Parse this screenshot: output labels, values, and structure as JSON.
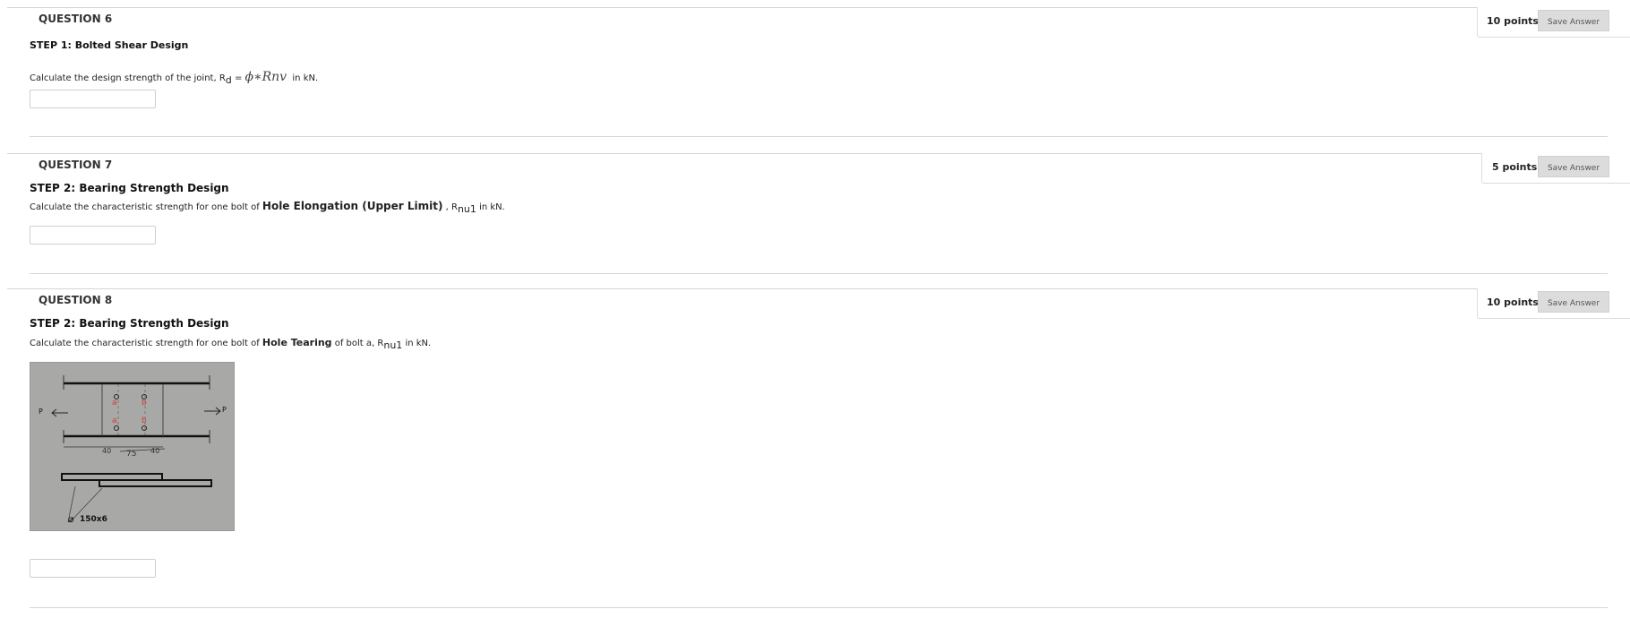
{
  "q6": {
    "title": "QUESTION 6",
    "points": "10 points",
    "save": "Save Answer",
    "step": "STEP 1: Bolted Shear Design",
    "prompt_pre": "Calculate the design strength of the joint, R",
    "prompt_sub": "d",
    "prompt_eq": " = ",
    "formula": "ϕ∗Rnv",
    "prompt_post": "  in kN.",
    "answer": ""
  },
  "q7": {
    "title": "QUESTION 7",
    "points": "5 points",
    "save": "Save Answer",
    "step": "STEP 2: Bearing Strength Design",
    "prompt_pre": "Calculate the characteristic strength for one bolt of ",
    "prompt_bold": "Hole Elongation (Upper Limit)",
    "prompt_mid": " , R",
    "prompt_sub": "nu1",
    "prompt_post": " in kN.",
    "answer": ""
  },
  "q8": {
    "title": "QUESTION 8",
    "points": "10 points",
    "save": "Save Answer",
    "step": "STEP 2: Bearing Strength Design",
    "prompt_pre": "Calculate the characteristic strength for one bolt of ",
    "prompt_bold": "Hole Tearing",
    "prompt_mid": " of bolt a, R",
    "prompt_sub": "nu1",
    "prompt_post": " in kN.",
    "answer": "",
    "figure": {
      "load_left": "P",
      "load_right": "P",
      "bolt_a": "a",
      "bolt_b": "b",
      "dim_1": "40",
      "dim_2": "75",
      "dim_3": "40",
      "plate_label": "150x6"
    }
  },
  "colors": {
    "bolt_label": "#d43a3a",
    "figure_bg": "#a8a8a6",
    "button_bg": "#dcdcdc"
  }
}
